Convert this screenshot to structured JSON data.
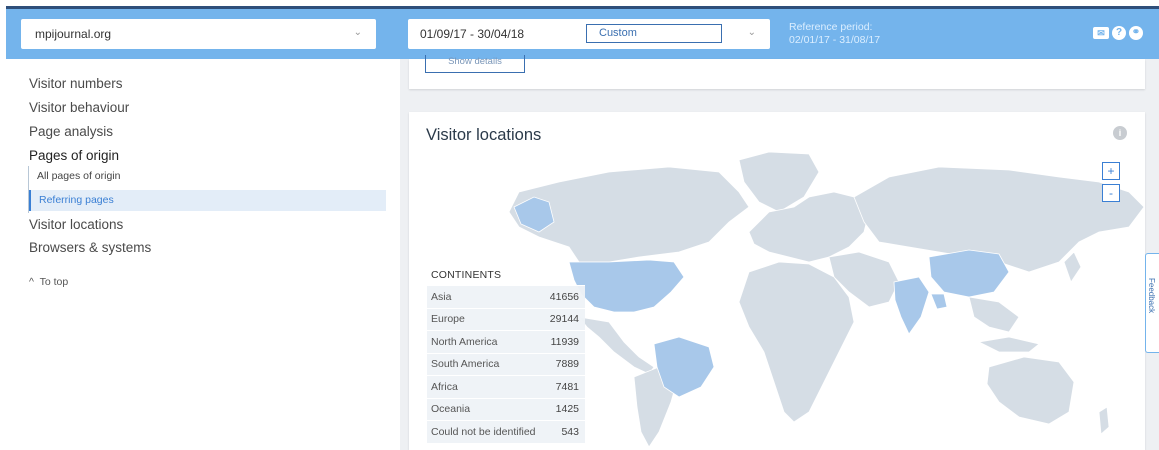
{
  "header": {
    "site": "mpijournal.org",
    "date_range": "01/09/17 - 30/04/18",
    "range_mode": "Custom",
    "reference_label": "Reference period:",
    "reference_dates": "02/01/17 - 31/08/17",
    "icons": [
      "mail-icon",
      "help-icon",
      "link-icon"
    ]
  },
  "sidebar": {
    "items": [
      {
        "label": "Visitor numbers"
      },
      {
        "label": "Visitor behaviour"
      },
      {
        "label": "Page analysis"
      },
      {
        "label": "Pages of origin"
      },
      {
        "label": "Visitor locations"
      },
      {
        "label": "Browsers & systems"
      }
    ],
    "sub_items": [
      {
        "label": "All pages of origin"
      },
      {
        "label": "Referring pages"
      }
    ],
    "to_top": "To top"
  },
  "main": {
    "show_details": "Show details",
    "card_title": "Visitor locations",
    "zoom_in": "+",
    "zoom_out": "-",
    "legend": {
      "heading": "CONTINENTS",
      "rows": [
        {
          "name": "Asia",
          "value": "41656"
        },
        {
          "name": "Europe",
          "value": "29144"
        },
        {
          "name": "North America",
          "value": "11939"
        },
        {
          "name": "South America",
          "value": "7889"
        },
        {
          "name": "Africa",
          "value": "7481"
        },
        {
          "name": "Oceania",
          "value": "1425"
        },
        {
          "name": "Could not be identified",
          "value": "543"
        }
      ]
    }
  },
  "feedback": "Feedback",
  "colors": {
    "header_bg": "#74b4ec",
    "accent": "#3a7fd4",
    "map_land": "#d5dde5",
    "map_highlight": "#a8c8ea"
  }
}
